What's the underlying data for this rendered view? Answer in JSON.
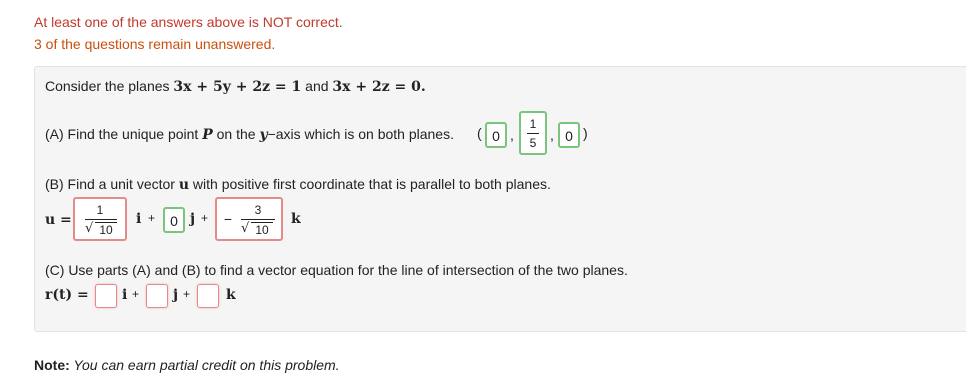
{
  "status": {
    "incorrect": "At least one of the answers above is NOT correct.",
    "unanswered": "3 of the questions remain unanswered."
  },
  "intro": {
    "prefix": "Consider the planes ",
    "plane1": "3x + 5y + 2z = 1",
    "and": " and ",
    "plane2": "3x + 2z = 0."
  },
  "part_a": {
    "text_before": "(A) Find the unique point ",
    "P": "P",
    "text_mid": " on the ",
    "yaxis": "y",
    "text_after": "−axis which is on both planes.",
    "open": "(",
    "comma1": ",",
    "comma2": ",",
    "close": ")",
    "answer_x": "0",
    "answer_y_num": "1",
    "answer_y_den": "5",
    "answer_z": "0"
  },
  "part_b": {
    "text_before": "(B) Find a unit vector ",
    "u": "u",
    "text_after": " with positive first coordinate that is parallel to both planes.",
    "u_label": "u =",
    "ans1_num": "1",
    "ans1_den": "10",
    "i": "i",
    "plus1": "+",
    "ans2": "0",
    "j": "j",
    "plus2": "+",
    "ans3_sign": "−",
    "ans3_num": "3",
    "ans3_den": "10",
    "k": "k"
  },
  "part_c": {
    "text": "(C) Use parts (A) and (B) to find a vector equation for the line of intersection of the two planes.",
    "r_label": "r(t) =",
    "i": "i",
    "plus1": "+",
    "j": "j",
    "plus2": "+",
    "k": "k",
    "input1": "",
    "input2": "",
    "input3": ""
  },
  "note": {
    "label": "Note:",
    "text": " You can earn partial credit on this problem."
  }
}
